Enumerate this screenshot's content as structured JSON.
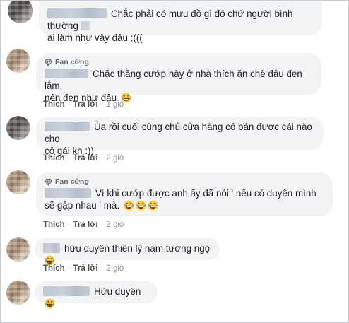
{
  "comments": [
    {
      "text_line1": "Chắc phải có mưu đồ gì đó chứ người bình thường",
      "text_line2": "ai làm như vậy đâu :((("
    },
    {
      "badge": "Fan cứng",
      "text_line1": "Chắc thằng cướp này ở nhà thích ăn chè đậu đen lắm,",
      "text_line2": "nên đen như đậu",
      "emoji_count": 1,
      "like_label": "Thích",
      "reply_label": "Trả lời",
      "time": "1 giờ"
    },
    {
      "text_line1": "Ủa rồi cuối cùng chủ cửa hàng có bán được cái nào cho",
      "text_line2": "cô gái kh :))",
      "like_label": "Thích",
      "reply_label": "Trả lời",
      "time": "2 giờ"
    },
    {
      "badge": "Fan cứng",
      "text_line1": "Vì khi cướp được anh ấy đã nói ' nếu có duyên mình",
      "text_line2": "sẽ gặp nhau ' mà.",
      "emoji_count": 3,
      "like_label": "Thích",
      "reply_label": "Trả lời",
      "time": "2 giờ"
    },
    {
      "text_line1": "hữu duyên thiên lý nam tương ngộ",
      "emoji_count": 1,
      "like_label": "Thích",
      "reply_label": "Trả lời",
      "time": "2 giờ"
    },
    {
      "text_line1": "Hữu duyên",
      "emoji_count": 1
    }
  ],
  "separator": "·",
  "colors": {
    "bubble": "#f2f3f5",
    "text": "#1c1e21",
    "meta": "#606770",
    "emoji_face": "#f7c843"
  },
  "icons": {
    "badge": "diamond-icon",
    "emoji": "laughing-tears-emoji-icon"
  }
}
